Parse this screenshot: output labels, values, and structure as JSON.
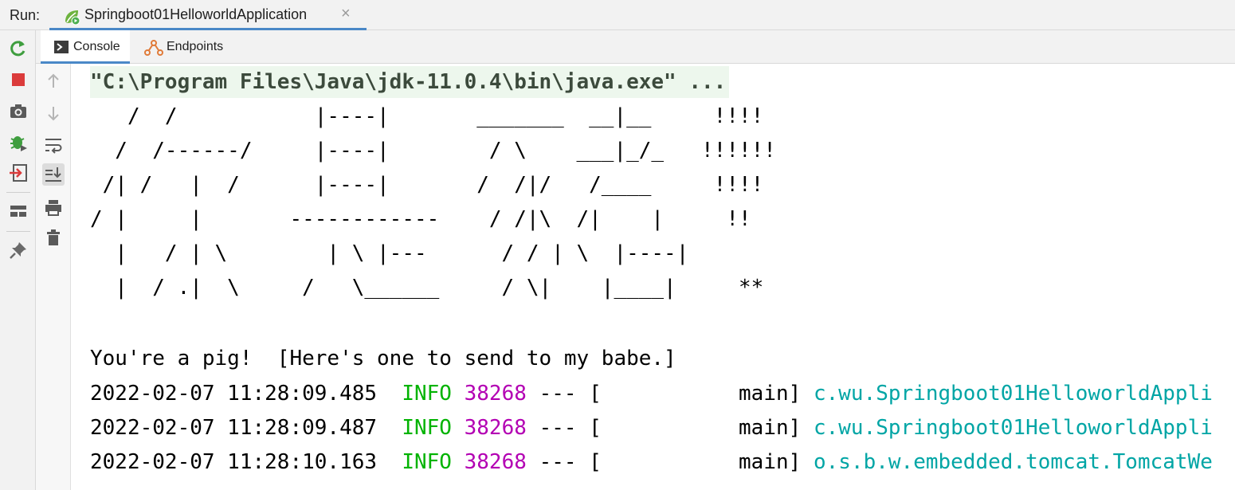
{
  "run_bar": {
    "label": "Run:",
    "tab_title": "Springboot01HelloworldApplication",
    "tab_icon": "spring-leaf-icon",
    "close_glyph": "×"
  },
  "left_toolbar": [
    {
      "name": "rerun-button",
      "icon": "rerun-icon"
    },
    {
      "name": "stop-button",
      "icon": "stop-icon"
    },
    {
      "name": "dump-threads-button",
      "icon": "camera-icon"
    },
    {
      "name": "debug-button",
      "icon": "bug-icon"
    },
    {
      "name": "exit-button",
      "icon": "exit-icon"
    },
    {
      "name": "layout-button",
      "icon": "layout-icon"
    },
    {
      "name": "pin-tab-button",
      "icon": "pin-icon"
    }
  ],
  "sub_tabs": [
    {
      "label": "Console",
      "icon": "console-icon",
      "active": true
    },
    {
      "label": "Endpoints",
      "icon": "endpoints-icon",
      "active": false
    }
  ],
  "console_toolbar": [
    {
      "name": "scroll-up-button",
      "icon": "arrow-up-icon"
    },
    {
      "name": "scroll-down-button",
      "icon": "arrow-down-icon"
    },
    {
      "name": "soft-wrap-button",
      "icon": "soft-wrap-icon"
    },
    {
      "name": "scroll-to-end-button",
      "icon": "scroll-to-end-icon",
      "pressed": true
    },
    {
      "name": "print-button",
      "icon": "print-icon"
    },
    {
      "name": "clear-all-button",
      "icon": "trash-icon"
    }
  ],
  "colors": {
    "info": "#00b300",
    "pid": "#b300b3",
    "logger": "#00a5a5",
    "accent": "#4a88c7"
  },
  "console": {
    "command": "\"C:\\Program Files\\Java\\jdk-11.0.4\\bin\\java.exe\" ...",
    "banner": [
      "   /  /           |----|       _______  __|__     !!!!",
      "  /  /------/     |----|        / \\    ___|_/_   !!!!!!",
      " /| /   |  /      |----|       /  /|/   /____     !!!!",
      "/ |     |       ------------    / /|\\  /|    |     !!",
      "  |   / | \\        | \\ |---      / / | \\  |----|",
      "  |  / .|  \\     /   \\______     / \\|    |____|     **"
    ],
    "message": "You're a pig!  [Here's one to send to my babe.]",
    "log_lines": [
      {
        "timestamp": "2022-02-07 11:28:09.485",
        "level": "INFO",
        "pid": "38268",
        "sep": "---",
        "bracket_open": "[",
        "thread": "main",
        "bracket_close": "]",
        "logger": "c.wu.Springboot01HelloworldAppli"
      },
      {
        "timestamp": "2022-02-07 11:28:09.487",
        "level": "INFO",
        "pid": "38268",
        "sep": "---",
        "bracket_open": "[",
        "thread": "main",
        "bracket_close": "]",
        "logger": "c.wu.Springboot01HelloworldAppli"
      },
      {
        "timestamp": "2022-02-07 11:28:10.163",
        "level": "INFO",
        "pid": "38268",
        "sep": "---",
        "bracket_open": "[",
        "thread": "main",
        "bracket_close": "]",
        "logger": "o.s.b.w.embedded.tomcat.TomcatWe"
      }
    ]
  }
}
